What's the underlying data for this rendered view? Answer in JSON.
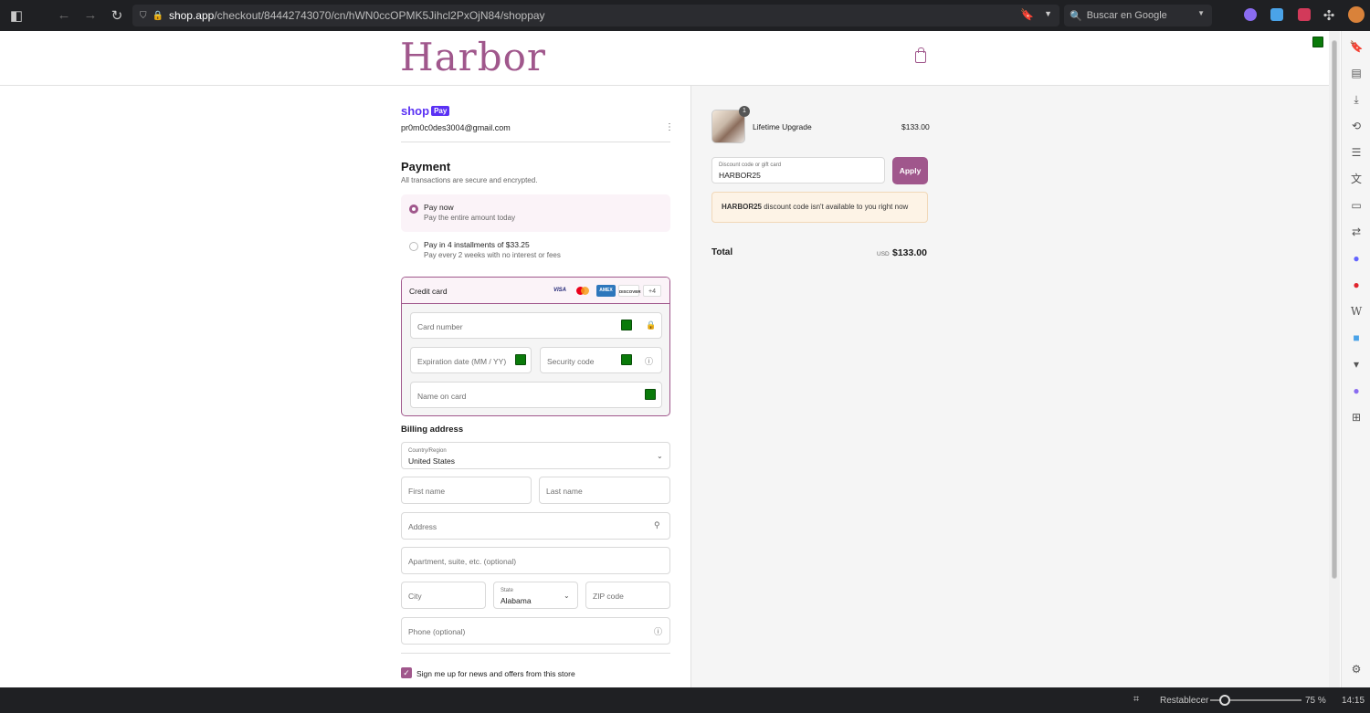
{
  "browser": {
    "url_host": "shop.app",
    "url_path": "/checkout/84442743070/cn/hWN0ccOPMK5Jihcl2PxOjN84/shoppay",
    "search_placeholder": "Buscar en Google",
    "zoom_reset": "Restablecer",
    "zoom_level": "75 %",
    "clock": "14:15"
  },
  "store": {
    "logo": "Harbor",
    "accent": "#a0578c"
  },
  "account": {
    "shop_label": "shop",
    "pay_label": "Pay",
    "email": "pr0m0c0des3004@gmail.com"
  },
  "payment": {
    "title": "Payment",
    "subtitle": "All transactions are secure and encrypted.",
    "options": [
      {
        "title": "Pay now",
        "desc": "Pay the entire amount today"
      },
      {
        "title": "Pay in 4 installments of $33.25",
        "desc": "Pay every 2 weeks with no interest or fees"
      }
    ],
    "credit_card_label": "Credit card",
    "cards": [
      "VISA",
      "MC",
      "AMEX",
      "DISCOVER"
    ],
    "more_cards": "+4",
    "card_number": "Card number",
    "expiration": "Expiration date (MM / YY)",
    "security_code": "Security code",
    "name_on_card": "Name on card"
  },
  "billing": {
    "title": "Billing address",
    "country_label": "Country/Region",
    "country_value": "United States",
    "first_name": "First name",
    "last_name": "Last name",
    "address": "Address",
    "apartment": "Apartment, suite, etc. (optional)",
    "city": "City",
    "state_label": "State",
    "state_value": "Alabama",
    "zip": "ZIP code",
    "phone": "Phone (optional)",
    "newsletter": "Sign me up for news and offers from this store"
  },
  "summary": {
    "item_qty": "1",
    "item_name": "Lifetime Upgrade",
    "item_price": "$133.00",
    "discount_label": "Discount code or gift card",
    "discount_value": "HARBOR25",
    "apply": "Apply",
    "alert_code": "HARBOR25",
    "alert_text": " discount code isn't available to you right now",
    "total_label": "Total",
    "total_currency": "USD",
    "total_value": "$133.00"
  }
}
